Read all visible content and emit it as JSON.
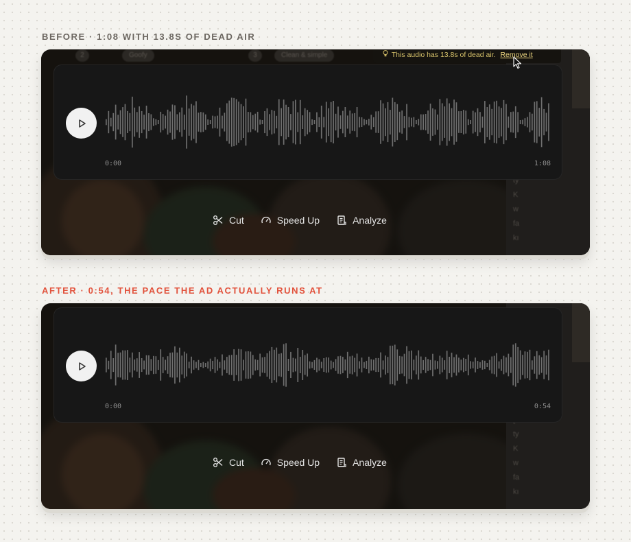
{
  "before": {
    "label": "BEFORE · 1:08 WITH 13.8s OF DEAD AIR",
    "notice_text": "This audio has 13.8s of dead air.",
    "notice_link": "Remove it",
    "time_start": "0:00",
    "time_end": "1:08",
    "bg_chips": [
      "2",
      "Goofy",
      "3",
      "Clean & simple"
    ],
    "side_text": [
      "[s",
      "ty",
      "K",
      "w",
      "fa",
      "kı"
    ]
  },
  "after": {
    "label": "AFTER · 0:54, THE PACE THE AD ACTUALLY RUNS AT",
    "time_start": "0:00",
    "time_end": "0:54",
    "side_text": [
      "[s",
      "ty",
      "K",
      "w",
      "fa",
      "kı"
    ]
  },
  "toolbar": {
    "cut_label": "Cut",
    "speedup_label": "Speed Up",
    "analyze_label": "Analyze"
  },
  "icons": {
    "play": "play-icon",
    "cut": "scissors-icon",
    "speedup": "gauge-icon",
    "analyze": "scroll-icon",
    "notice": "lightbulb-icon",
    "cursor": "mouse-pointer-icon"
  },
  "colors": {
    "background": "#f4f3ef",
    "label_before": "#6b6660",
    "label_after": "#e2533d",
    "panel": "#171717",
    "waveform": "#6f6f6f",
    "notice_text": "#d8c36b"
  }
}
